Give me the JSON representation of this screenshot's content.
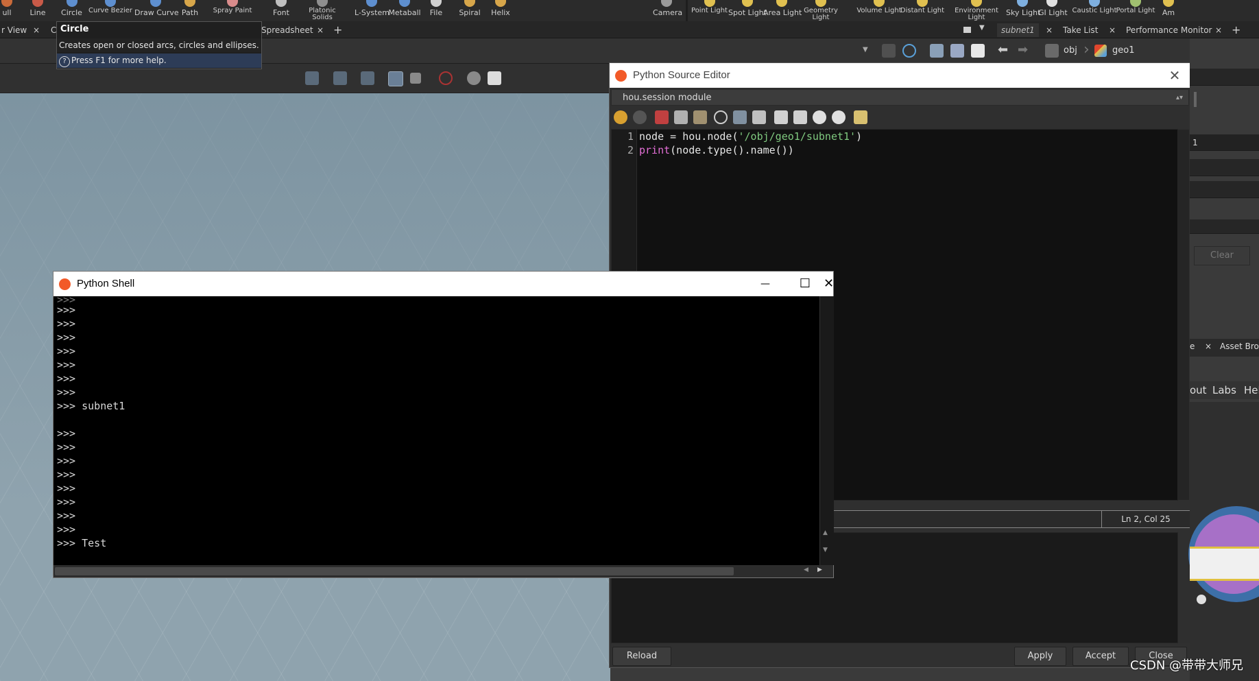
{
  "shelf": {
    "tools": [
      {
        "label": "ull",
        "color": "#c96a3a"
      },
      {
        "label": "Line",
        "color": "#c85a48"
      },
      {
        "label": "Circle",
        "color": "#5e8fcf"
      },
      {
        "label": "Curve Bezier",
        "color": "#5e8fcf"
      },
      {
        "label": "Draw Curve",
        "color": "#5e8fcf"
      },
      {
        "label": "Path",
        "color": "#d7a64a"
      },
      {
        "label": "Spray Paint",
        "color": "#d98c8c"
      },
      {
        "label": "Font",
        "color": "#bfbfbf"
      },
      {
        "label": "Platonic Solids",
        "color": "#8f8f8f"
      },
      {
        "label": "L-System",
        "color": "#5e8fcf"
      },
      {
        "label": "Metaball",
        "color": "#5e8fcf"
      },
      {
        "label": "File",
        "color": "#d0d0d0"
      },
      {
        "label": "Spiral",
        "color": "#d7a64a"
      },
      {
        "label": "Helix",
        "color": "#d7a64a"
      },
      {
        "label": "Camera",
        "color": "#9a9a9a"
      },
      {
        "label": "Point Light",
        "color": "#e0c050"
      },
      {
        "label": "Spot Light",
        "color": "#e0c050"
      },
      {
        "label": "Area Light",
        "color": "#e0c050"
      },
      {
        "label": "Geometry Light",
        "color": "#e0c050"
      },
      {
        "label": "Volume Light",
        "color": "#e0c050"
      },
      {
        "label": "Distant Light",
        "color": "#e0c050"
      },
      {
        "label": "Environment Light",
        "color": "#e0c050"
      },
      {
        "label": "Sky Light",
        "color": "#7fb0e0"
      },
      {
        "label": "GI Light",
        "color": "#e0e0e0"
      },
      {
        "label": "Caustic Light",
        "color": "#7fb0e0"
      },
      {
        "label": "Portal Light",
        "color": "#a0c070"
      },
      {
        "label": "Am",
        "color": "#e0c050"
      }
    ]
  },
  "tabs": {
    "left": [
      {
        "label": "r View",
        "close": "×"
      },
      {
        "label": "C",
        "close": ""
      },
      {
        "label": "Spreadsheet",
        "close": "×"
      }
    ],
    "add": "+",
    "right": [
      {
        "label": "subnet1",
        "close": "×"
      },
      {
        "label": "Take List",
        "close": "×"
      },
      {
        "label": "Performance Monitor",
        "close": "×"
      }
    ]
  },
  "breadcrumb": {
    "obj": "obj",
    "geo1": "geo1"
  },
  "tooltip": {
    "title": "Circle",
    "description": "Creates open or closed arcs, circles and ellipses.",
    "help": "Press F1 for more help."
  },
  "python_shell": {
    "title": "Python Shell",
    "minimize": "—",
    "maximize": "☐",
    "close": "✕",
    "lines": [
      ">>>",
      ">>>",
      ">>>",
      ">>>",
      ">>>",
      ">>>",
      ">>>",
      ">>> subnet1",
      "",
      ">>>",
      ">>>",
      ">>>",
      ">>>",
      ">>>",
      ">>>",
      ">>>",
      ">>>",
      ">>> Test"
    ]
  },
  "source_editor": {
    "title": "Python Source Editor",
    "close": "✕",
    "module": "hou.session module",
    "line_numbers": [
      "1",
      "2"
    ],
    "code_line1": {
      "a": "node = hou.node(",
      "s": "'/obj/geo1/subnet1'",
      "b": ")"
    },
    "code_line2": {
      "kw": "print",
      "rest": "(node.type().name())"
    },
    "cursor_pos": "Ln 2, Col 25",
    "buttons": {
      "reload": "Reload",
      "apply": "Apply",
      "accept": "Accept",
      "close": "Close"
    }
  },
  "right_panel": {
    "field_value": "1",
    "clear": "Clear",
    "tab_e": "e",
    "asset_browser": "Asset Brov",
    "menu_out": "out",
    "menu_labs": "Labs",
    "menu_help": "Hel"
  },
  "watermark": "CSDN @带带大师兄"
}
